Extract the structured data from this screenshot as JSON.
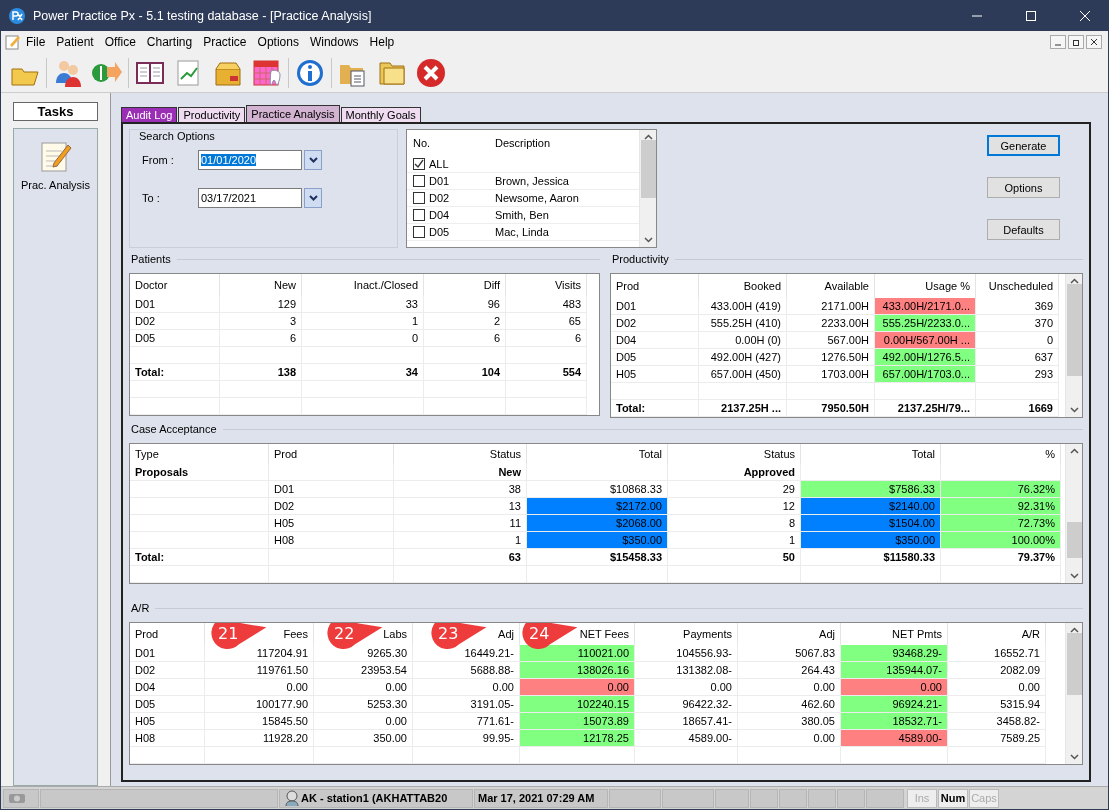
{
  "window": {
    "title": "Power Practice Px - 5.1 testing database - [Practice Analysis]"
  },
  "menu": [
    "File",
    "Patient",
    "Office",
    "Charting",
    "Practice",
    "Options",
    "Windows",
    "Help"
  ],
  "tasks": {
    "title": "Tasks",
    "items": [
      {
        "label": "Prac. Analysis"
      }
    ]
  },
  "tabs": [
    {
      "label": "Audit Log",
      "selected": false,
      "color": "#9a2fb5"
    },
    {
      "label": "Productivity",
      "selected": false,
      "color": "#f0dcf0"
    },
    {
      "label": "Practice Analysis",
      "selected": true,
      "color": "#d2b4d2"
    },
    {
      "label": "Monthly Goals",
      "selected": false,
      "color": "#f0dcf0"
    }
  ],
  "search_options": {
    "title": "Search Options",
    "from": {
      "label": "From :",
      "value": "01/01/2020",
      "selected": true
    },
    "to": {
      "label": "To :",
      "value": "03/17/2021",
      "selected": false
    }
  },
  "doctor_list": {
    "columns": [
      "No.",
      "Description"
    ],
    "rows": [
      {
        "no": "ALL",
        "description": "",
        "checked": true
      },
      {
        "no": "D01",
        "description": "Brown, Jessica",
        "checked": false
      },
      {
        "no": "D02",
        "description": "Newsome, Aaron",
        "checked": false
      },
      {
        "no": "D04",
        "description": "Smith, Ben",
        "checked": false
      },
      {
        "no": "D05",
        "description": "Mac, Linda",
        "checked": false
      }
    ]
  },
  "buttons": [
    {
      "label": "Generate",
      "default": true
    },
    {
      "label": "Options",
      "default": false
    },
    {
      "label": "Defaults",
      "default": false
    }
  ],
  "patients": {
    "title": "Patients",
    "columns": [
      "Doctor",
      "New",
      "Inact./Closed",
      "Diff",
      "Visits"
    ],
    "rows": [
      {
        "kind": "item",
        "cells": [
          "D01",
          "129",
          "33",
          "96",
          "483"
        ]
      },
      {
        "kind": "item",
        "cells": [
          "D02",
          "3",
          "1",
          "2",
          "65"
        ]
      },
      {
        "kind": "item",
        "cells": [
          "D05",
          "6",
          "0",
          "6",
          "6"
        ]
      },
      {
        "kind": "blank",
        "cells": []
      },
      {
        "kind": "total",
        "cells": [
          "Total:",
          "138",
          "34",
          "104",
          "554"
        ]
      }
    ]
  },
  "productivity": {
    "title": "Productivity",
    "columns": [
      "Prod",
      "Booked",
      "Available",
      "Usage %",
      "Unscheduled"
    ],
    "rows": [
      {
        "kind": "item",
        "cells": [
          "D01",
          "433.00H  (419)",
          "2171.00H",
          {
            "text": "433.00H/2171.0...",
            "color": "#ff8080"
          },
          "369"
        ]
      },
      {
        "kind": "item",
        "cells": [
          "D02",
          "555.25H  (410)",
          "2233.00H",
          {
            "text": "555.25H/2233.0...",
            "color": "#80ff80"
          },
          "370"
        ]
      },
      {
        "kind": "item",
        "cells": [
          "D04",
          "0.00H  (0)",
          "567.00H",
          {
            "text": "0.00H/567.00H ...",
            "color": "#ff8080"
          },
          "0"
        ]
      },
      {
        "kind": "item",
        "cells": [
          "D05",
          "492.00H  (427)",
          "1276.50H",
          {
            "text": "492.00H/1276.5...",
            "color": "#80ff80"
          },
          "637"
        ]
      },
      {
        "kind": "item",
        "cells": [
          "H05",
          "657.00H  (450)",
          "1703.00H",
          {
            "text": "657.00H/1703.0...",
            "color": "#80ff80"
          },
          "293"
        ]
      },
      {
        "kind": "blank",
        "cells": []
      },
      {
        "kind": "total",
        "cells": [
          "Total:",
          "2137.25H   ...",
          "7950.50H",
          "2137.25H/79...",
          "1669"
        ]
      }
    ]
  },
  "case_acceptance": {
    "title": "Case Acceptance",
    "columns": [
      "Type",
      "Prod",
      "Status",
      "Total",
      "Status",
      "Total",
      "%"
    ],
    "rows": [
      {
        "kind": "group",
        "cells": [
          "Proposals",
          "",
          "New",
          "",
          "Approved",
          "",
          ""
        ]
      },
      {
        "kind": "item",
        "cells": [
          "",
          "D01",
          "38",
          "$10868.33",
          "29",
          {
            "text": "$7586.33",
            "color": "#80ff80"
          },
          {
            "text": "76.32%",
            "color": "#80ff80"
          }
        ]
      },
      {
        "kind": "item",
        "cells": [
          "",
          "D02",
          "13",
          {
            "text": "$2172.00",
            "color": "#0080ff"
          },
          "12",
          {
            "text": "$2140.00",
            "color": "#0080ff"
          },
          {
            "text": "92.31%",
            "color": "#80ff80"
          }
        ]
      },
      {
        "kind": "item",
        "cells": [
          "",
          "H05",
          "11",
          {
            "text": "$2068.00",
            "color": "#0080ff"
          },
          "8",
          {
            "text": "$1504.00",
            "color": "#0080ff"
          },
          {
            "text": "72.73%",
            "color": "#80ff80"
          }
        ]
      },
      {
        "kind": "item",
        "cells": [
          "",
          "H08",
          "1",
          {
            "text": "$350.00",
            "color": "#0080ff"
          },
          "1",
          {
            "text": "$350.00",
            "color": "#0080ff"
          },
          {
            "text": "100.00%",
            "color": "#80ff80"
          }
        ]
      },
      {
        "kind": "total",
        "cells": [
          "Total:",
          "",
          "63",
          "$15458.33",
          "50",
          "$11580.33",
          "79.37%"
        ]
      }
    ]
  },
  "ar": {
    "title": "A/R",
    "columns": [
      "Prod",
      "Fees",
      "Labs",
      "Adj",
      "NET Fees",
      "Payments",
      "Adj",
      "NET Pmts",
      "A/R"
    ],
    "rows": [
      {
        "kind": "item",
        "cells": [
          "D01",
          "117204.91",
          "9265.30",
          "16449.21-",
          {
            "text": "110021.00",
            "color": "#80ff80"
          },
          "104556.93-",
          "5067.83",
          {
            "text": "93468.29-",
            "color": "#80ff80"
          },
          "16552.71"
        ]
      },
      {
        "kind": "item",
        "cells": [
          "D02",
          "119761.50",
          "23953.54",
          "5688.88-",
          {
            "text": "138026.16",
            "color": "#80ff80"
          },
          "131382.08-",
          "264.43",
          {
            "text": "135944.07-",
            "color": "#80ff80"
          },
          "2082.09"
        ]
      },
      {
        "kind": "item",
        "cells": [
          "D04",
          "0.00",
          "0.00",
          "0.00",
          {
            "text": "0.00",
            "color": "#ff8080"
          },
          "0.00",
          "0.00",
          {
            "text": "0.00",
            "color": "#ff8080"
          },
          "0.00"
        ]
      },
      {
        "kind": "item",
        "cells": [
          "D05",
          "100177.90",
          "5253.30",
          "3191.05-",
          {
            "text": "102240.15",
            "color": "#80ff80"
          },
          "96422.32-",
          "462.60",
          {
            "text": "96924.21-",
            "color": "#80ff80"
          },
          "5315.94"
        ]
      },
      {
        "kind": "item",
        "cells": [
          "H05",
          "15845.50",
          "0.00",
          "771.61-",
          {
            "text": "15073.89",
            "color": "#80ff80"
          },
          "18657.41-",
          "380.05",
          {
            "text": "18532.71-",
            "color": "#80ff80"
          },
          "3458.82-"
        ]
      },
      {
        "kind": "item",
        "cells": [
          "H08",
          "11928.20",
          "350.00",
          "99.95-",
          {
            "text": "12178.25",
            "color": "#80ff80"
          },
          "4589.00-",
          "0.00",
          {
            "text": "4589.00-",
            "color": "#ff8080"
          },
          "7589.25"
        ]
      }
    ],
    "callouts": [
      "21",
      "22",
      "23",
      "24"
    ]
  },
  "status_bar": {
    "station": "AK - station1 (AKHATTAB20",
    "datetime": "Mar 17, 2021 07:29 AM",
    "indicators": [
      {
        "label": "Ins",
        "on": false
      },
      {
        "label": "Num",
        "on": true
      },
      {
        "label": "Caps",
        "on": false
      }
    ]
  }
}
